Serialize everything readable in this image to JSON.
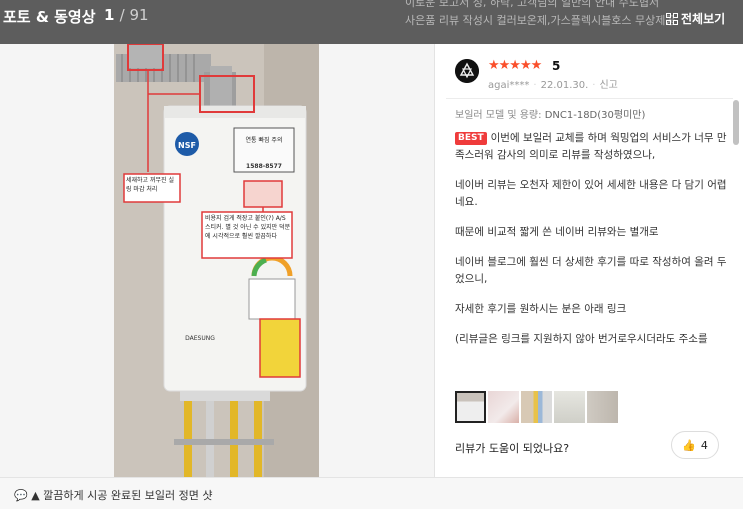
{
  "background": {
    "line1": "이로운  보고서 성, 하락, 고객님의 일반의 안내 수도협서",
    "line2": "사은품   리뷰 작성시 컬러보온제,가스플렉시블호스 무상제공"
  },
  "header": {
    "title": "포토 & 동영상",
    "current": "1",
    "total": "/ 91",
    "view_all": "전체보기"
  },
  "photo": {
    "label1": "NSF",
    "label2": "연통 빠짐 주의",
    "phone": "1588-8577",
    "brand": "DAESUNG",
    "note1": "세재하고 꺼무진 실링 마감 처리",
    "note2": "비용지 검게 적장고 붙인(?) A/S 스티커. 별 것 아닌 수 있지만 덕분에 시각적으로 훨씬 깔끔하다"
  },
  "review": {
    "stars": "★★★★★",
    "score": "5",
    "user": "agai****",
    "date": "22.01.30.",
    "report": "신고",
    "option_label": "보일러 모델 및 용량:",
    "option_value": "DNC1-18D(30평미만)",
    "best": "BEST",
    "p1": "이번에 보일러 교체를 하며 웍밍업의 서비스가 너무 만족스러워 감사의 의미로 리뷰를 작성하였으나,",
    "p2": "네이버 리뷰는 오천자 제한이 있어 세세한 내용은 다 담기 어렵네요.",
    "p3": "때문에 비교적 짧게 쓴 네이버 리뷰와는 별개로",
    "p4": "네이버 블로그에 훨씬 더 상세한 후기를 따로 작성하여 올려 두었으니,",
    "p5": "자세한 후기를 원하시는 분은 아래 링크",
    "p6": "(리뷰글은 링크를 지원하지 않아 번거로우시더라도 주소를",
    "helpful_q": "리뷰가 도움이 되었나요?",
    "likes": "4"
  },
  "caption": "▲ 깔끔하게 시공 완료된 보일러 정면 샷",
  "colors": {
    "accent": "#fa4f2b",
    "best": "#ef3b3b"
  }
}
